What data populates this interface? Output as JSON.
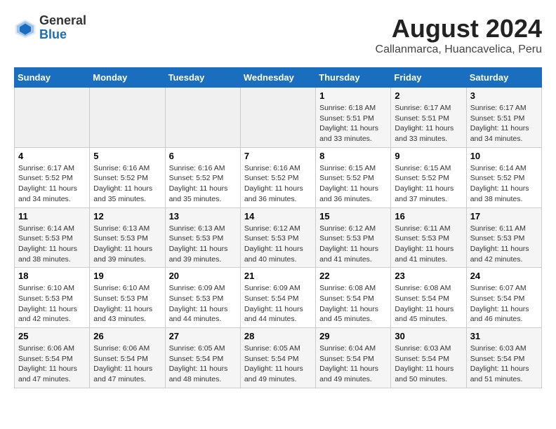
{
  "header": {
    "logo_general": "General",
    "logo_blue": "Blue",
    "title": "August 2024",
    "subtitle": "Callanmarca, Huancavelica, Peru"
  },
  "days_of_week": [
    "Sunday",
    "Monday",
    "Tuesday",
    "Wednesday",
    "Thursday",
    "Friday",
    "Saturday"
  ],
  "weeks": [
    [
      {
        "day": "",
        "info": ""
      },
      {
        "day": "",
        "info": ""
      },
      {
        "day": "",
        "info": ""
      },
      {
        "day": "",
        "info": ""
      },
      {
        "day": "1",
        "info": "Sunrise: 6:18 AM\nSunset: 5:51 PM\nDaylight: 11 hours and 33 minutes."
      },
      {
        "day": "2",
        "info": "Sunrise: 6:17 AM\nSunset: 5:51 PM\nDaylight: 11 hours and 33 minutes."
      },
      {
        "day": "3",
        "info": "Sunrise: 6:17 AM\nSunset: 5:51 PM\nDaylight: 11 hours and 34 minutes."
      }
    ],
    [
      {
        "day": "4",
        "info": "Sunrise: 6:17 AM\nSunset: 5:52 PM\nDaylight: 11 hours and 34 minutes."
      },
      {
        "day": "5",
        "info": "Sunrise: 6:16 AM\nSunset: 5:52 PM\nDaylight: 11 hours and 35 minutes."
      },
      {
        "day": "6",
        "info": "Sunrise: 6:16 AM\nSunset: 5:52 PM\nDaylight: 11 hours and 35 minutes."
      },
      {
        "day": "7",
        "info": "Sunrise: 6:16 AM\nSunset: 5:52 PM\nDaylight: 11 hours and 36 minutes."
      },
      {
        "day": "8",
        "info": "Sunrise: 6:15 AM\nSunset: 5:52 PM\nDaylight: 11 hours and 36 minutes."
      },
      {
        "day": "9",
        "info": "Sunrise: 6:15 AM\nSunset: 5:52 PM\nDaylight: 11 hours and 37 minutes."
      },
      {
        "day": "10",
        "info": "Sunrise: 6:14 AM\nSunset: 5:52 PM\nDaylight: 11 hours and 38 minutes."
      }
    ],
    [
      {
        "day": "11",
        "info": "Sunrise: 6:14 AM\nSunset: 5:53 PM\nDaylight: 11 hours and 38 minutes."
      },
      {
        "day": "12",
        "info": "Sunrise: 6:13 AM\nSunset: 5:53 PM\nDaylight: 11 hours and 39 minutes."
      },
      {
        "day": "13",
        "info": "Sunrise: 6:13 AM\nSunset: 5:53 PM\nDaylight: 11 hours and 39 minutes."
      },
      {
        "day": "14",
        "info": "Sunrise: 6:12 AM\nSunset: 5:53 PM\nDaylight: 11 hours and 40 minutes."
      },
      {
        "day": "15",
        "info": "Sunrise: 6:12 AM\nSunset: 5:53 PM\nDaylight: 11 hours and 41 minutes."
      },
      {
        "day": "16",
        "info": "Sunrise: 6:11 AM\nSunset: 5:53 PM\nDaylight: 11 hours and 41 minutes."
      },
      {
        "day": "17",
        "info": "Sunrise: 6:11 AM\nSunset: 5:53 PM\nDaylight: 11 hours and 42 minutes."
      }
    ],
    [
      {
        "day": "18",
        "info": "Sunrise: 6:10 AM\nSunset: 5:53 PM\nDaylight: 11 hours and 42 minutes."
      },
      {
        "day": "19",
        "info": "Sunrise: 6:10 AM\nSunset: 5:53 PM\nDaylight: 11 hours and 43 minutes."
      },
      {
        "day": "20",
        "info": "Sunrise: 6:09 AM\nSunset: 5:53 PM\nDaylight: 11 hours and 44 minutes."
      },
      {
        "day": "21",
        "info": "Sunrise: 6:09 AM\nSunset: 5:54 PM\nDaylight: 11 hours and 44 minutes."
      },
      {
        "day": "22",
        "info": "Sunrise: 6:08 AM\nSunset: 5:54 PM\nDaylight: 11 hours and 45 minutes."
      },
      {
        "day": "23",
        "info": "Sunrise: 6:08 AM\nSunset: 5:54 PM\nDaylight: 11 hours and 45 minutes."
      },
      {
        "day": "24",
        "info": "Sunrise: 6:07 AM\nSunset: 5:54 PM\nDaylight: 11 hours and 46 minutes."
      }
    ],
    [
      {
        "day": "25",
        "info": "Sunrise: 6:06 AM\nSunset: 5:54 PM\nDaylight: 11 hours and 47 minutes."
      },
      {
        "day": "26",
        "info": "Sunrise: 6:06 AM\nSunset: 5:54 PM\nDaylight: 11 hours and 47 minutes."
      },
      {
        "day": "27",
        "info": "Sunrise: 6:05 AM\nSunset: 5:54 PM\nDaylight: 11 hours and 48 minutes."
      },
      {
        "day": "28",
        "info": "Sunrise: 6:05 AM\nSunset: 5:54 PM\nDaylight: 11 hours and 49 minutes."
      },
      {
        "day": "29",
        "info": "Sunrise: 6:04 AM\nSunset: 5:54 PM\nDaylight: 11 hours and 49 minutes."
      },
      {
        "day": "30",
        "info": "Sunrise: 6:03 AM\nSunset: 5:54 PM\nDaylight: 11 hours and 50 minutes."
      },
      {
        "day": "31",
        "info": "Sunrise: 6:03 AM\nSunset: 5:54 PM\nDaylight: 11 hours and 51 minutes."
      }
    ]
  ]
}
